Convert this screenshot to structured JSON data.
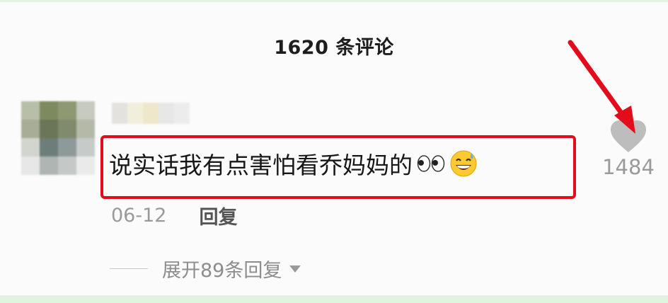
{
  "header": {
    "title": "1620 条评论"
  },
  "comment": {
    "text": "说实话我有点害怕看乔妈妈的",
    "emojis": [
      "eyes-emoji",
      "grinning-sweat-emoji"
    ],
    "date": "06-12",
    "reply_label": "回复",
    "like_count": "1484",
    "expand_label": "展开89条回复"
  },
  "colors": {
    "highlight_border": "#e30c1c",
    "annotation_arrow": "#e30c1c",
    "page_border": "#e3f3e1"
  },
  "icons": [
    "heart-icon",
    "caret-down-icon"
  ]
}
